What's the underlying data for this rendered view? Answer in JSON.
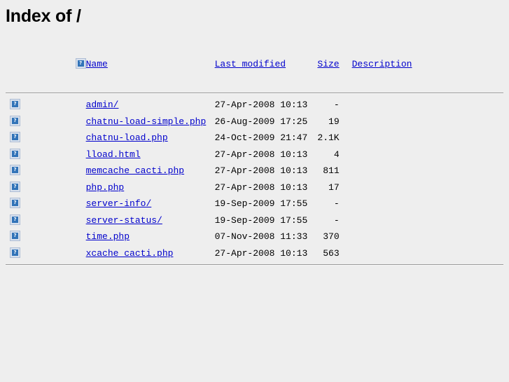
{
  "page": {
    "title": "Index of /",
    "background_color": "#eeeeee",
    "link_color": "#0000cc",
    "text_color": "#000000",
    "rule_color": "#9a9a9a"
  },
  "table": {
    "headers": {
      "icon": "",
      "name": "Name",
      "last_modified": "Last modified",
      "size": "Size",
      "description": "Description"
    },
    "icon_glyph": "?",
    "icon_name": "broken-image-icon",
    "rows": [
      {
        "icon": "?",
        "name": "admin/",
        "last_modified": "27-Apr-2008 10:13",
        "size": "-",
        "description": ""
      },
      {
        "icon": "?",
        "name": "chatnu-load-simple.php",
        "last_modified": "26-Aug-2009 17:25",
        "size": "19",
        "description": ""
      },
      {
        "icon": "?",
        "name": "chatnu-load.php",
        "last_modified": "24-Oct-2009 21:47",
        "size": "2.1K",
        "description": ""
      },
      {
        "icon": "?",
        "name": "lload.html",
        "last_modified": "27-Apr-2008 10:13",
        "size": "4",
        "description": ""
      },
      {
        "icon": "?",
        "name": "memcache_cacti.php",
        "last_modified": "27-Apr-2008 10:13",
        "size": "811",
        "description": ""
      },
      {
        "icon": "?",
        "name": "php.php",
        "last_modified": "27-Apr-2008 10:13",
        "size": "17",
        "description": ""
      },
      {
        "icon": "?",
        "name": "server-info/",
        "last_modified": "19-Sep-2009 17:55",
        "size": "-",
        "description": ""
      },
      {
        "icon": "?",
        "name": "server-status/",
        "last_modified": "19-Sep-2009 17:55",
        "size": "-",
        "description": ""
      },
      {
        "icon": "?",
        "name": "time.php",
        "last_modified": "07-Nov-2008 11:33",
        "size": "370",
        "description": ""
      },
      {
        "icon": "?",
        "name": "xcache_cacti.php",
        "last_modified": "27-Apr-2008 10:13",
        "size": "563",
        "description": ""
      }
    ]
  }
}
